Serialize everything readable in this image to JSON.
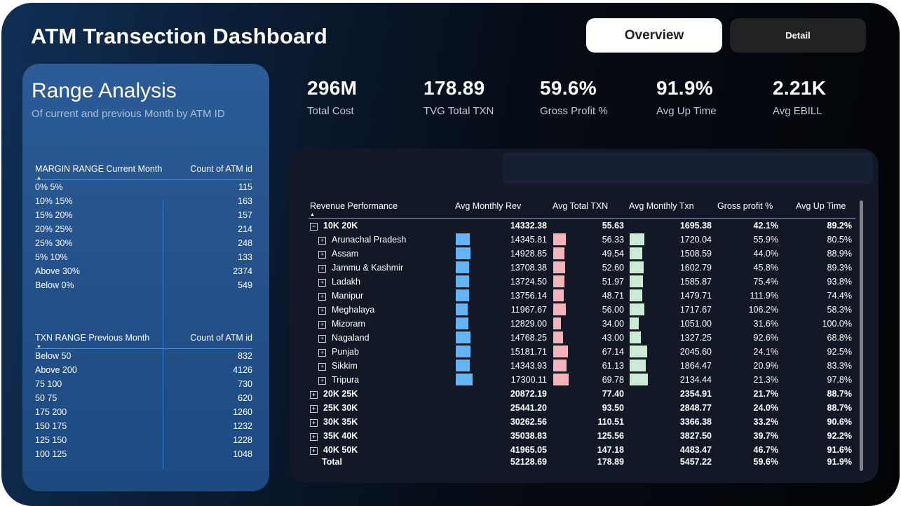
{
  "header": {
    "title": "ATM Transection Dashboard",
    "overview_label": "Overview",
    "detail_label": "Detail"
  },
  "range": {
    "title": "Range Analysis",
    "subtitle": "Of current and previous Month by ATM ID",
    "margin": {
      "col1": "MARGIN RANGE Current Month",
      "col2": "Count of ATM id",
      "rows": [
        [
          "0% 5%",
          "115"
        ],
        [
          "10% 15%",
          "163"
        ],
        [
          "15% 20%",
          "157"
        ],
        [
          "20% 25%",
          "214"
        ],
        [
          "25% 30%",
          "248"
        ],
        [
          "5% 10%",
          "133"
        ],
        [
          "Above 30%",
          "2374"
        ],
        [
          "Below 0%",
          "549"
        ]
      ]
    },
    "txn": {
      "col1": "TXN RANGE Previous Month",
      "col2": "Count of ATM id",
      "rows": [
        [
          "Below 50",
          "832"
        ],
        [
          "Above 200",
          "4126"
        ],
        [
          "75 100",
          "730"
        ],
        [
          "50 75",
          "620"
        ],
        [
          "175 200",
          "1260"
        ],
        [
          "150 175",
          "1232"
        ],
        [
          "125 150",
          "1228"
        ],
        [
          "100 125",
          "1048"
        ]
      ]
    }
  },
  "kpis": [
    {
      "value": "296M",
      "label": "Total Cost"
    },
    {
      "value": "178.89",
      "label": "TVG Total TXN"
    },
    {
      "value": "59.6%",
      "label": "Gross Profit %"
    },
    {
      "value": "91.9%",
      "label": "Avg Up Time"
    },
    {
      "value": "2.21K",
      "label": "Avg EBILL"
    }
  ],
  "matrix": {
    "headers": [
      "Revenue Performance",
      "Avg Monthly Rev",
      "Avg Total TXN",
      "Avg Monthly Txn",
      "Gross profit %",
      "Avg Up Time"
    ],
    "groups": [
      {
        "name": "10K 20K",
        "expanded": true,
        "rev": "14332.38",
        "txn": "55.63",
        "mtxn": "1695.38",
        "gp": "42.1%",
        "up": "89.2%",
        "children": [
          {
            "name": "Arunachal Pradesh",
            "rev": "14345.81",
            "txn": "56.33",
            "mtxn": "1720.04",
            "gp": "55.9%",
            "up": "80.5%"
          },
          {
            "name": "Assam",
            "rev": "14928.85",
            "txn": "49.54",
            "mtxn": "1508.59",
            "gp": "44.0%",
            "up": "88.9%"
          },
          {
            "name": "Jammu & Kashmir",
            "rev": "13708.38",
            "txn": "52.60",
            "mtxn": "1602.79",
            "gp": "45.8%",
            "up": "89.3%"
          },
          {
            "name": "Ladakh",
            "rev": "13724.50",
            "txn": "51.97",
            "mtxn": "1585.87",
            "gp": "75.4%",
            "up": "93.8%"
          },
          {
            "name": "Manipur",
            "rev": "13756.14",
            "txn": "48.71",
            "mtxn": "1479.71",
            "gp": "111.9%",
            "up": "74.4%"
          },
          {
            "name": "Meghalaya",
            "rev": "11967.67",
            "txn": "56.00",
            "mtxn": "1717.67",
            "gp": "106.2%",
            "up": "58.3%"
          },
          {
            "name": "Mizoram",
            "rev": "12829.00",
            "txn": "34.00",
            "mtxn": "1051.00",
            "gp": "31.6%",
            "up": "100.0%"
          },
          {
            "name": "Nagaland",
            "rev": "14768.25",
            "txn": "43.00",
            "mtxn": "1327.25",
            "gp": "92.6%",
            "up": "68.8%"
          },
          {
            "name": "Punjab",
            "rev": "15181.71",
            "txn": "67.14",
            "mtxn": "2045.60",
            "gp": "24.1%",
            "up": "92.5%"
          },
          {
            "name": "Sikkim",
            "rev": "14343.93",
            "txn": "61.13",
            "mtxn": "1864.47",
            "gp": "20.9%",
            "up": "83.3%"
          },
          {
            "name": "Tripura",
            "rev": "17300.11",
            "txn": "69.78",
            "mtxn": "2134.44",
            "gp": "21.3%",
            "up": "97.8%"
          }
        ]
      },
      {
        "name": "20K 25K",
        "rev": "20872.19",
        "txn": "77.40",
        "mtxn": "2354.91",
        "gp": "21.7%",
        "up": "88.7%"
      },
      {
        "name": "25K 30K",
        "rev": "25441.20",
        "txn": "93.50",
        "mtxn": "2848.77",
        "gp": "24.0%",
        "up": "88.7%"
      },
      {
        "name": "30K 35K",
        "rev": "30262.56",
        "txn": "110.51",
        "mtxn": "3366.38",
        "gp": "33.2%",
        "up": "90.6%"
      },
      {
        "name": "35K 40K",
        "rev": "35038.83",
        "txn": "125.56",
        "mtxn": "3827.50",
        "gp": "39.7%",
        "up": "92.2%"
      },
      {
        "name": "40K 50K",
        "rev": "41965.05",
        "txn": "147.18",
        "mtxn": "4483.47",
        "gp": "46.7%",
        "up": "91.6%"
      }
    ],
    "total": {
      "name": "Total",
      "rev": "52128.69",
      "txn": "178.89",
      "mtxn": "5457.22",
      "gp": "59.6%",
      "up": "91.9%"
    }
  },
  "colors": {
    "bar_rev": "#64b5f6",
    "bar_txn": "#f4b4b9",
    "bar_mtxn": "#cdebd4",
    "panel": "#2b5c97",
    "accent": "#4d8fd6"
  }
}
